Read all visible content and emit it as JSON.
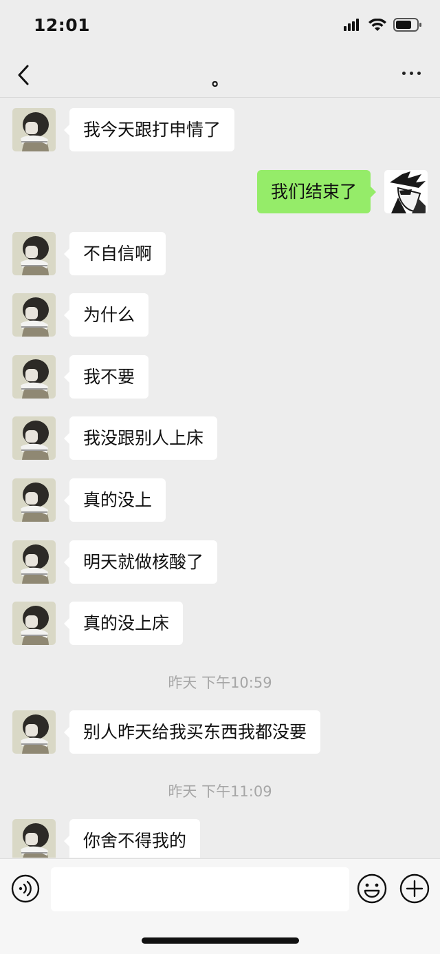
{
  "status_bar": {
    "time": "12:01",
    "signal_icon": "cellular-signal-icon",
    "wifi_icon": "wifi-icon",
    "battery_icon": "battery-icon"
  },
  "header": {
    "title": "。",
    "back_icon": "chevron-left-icon",
    "more_icon": "more-dots-icon"
  },
  "messages": [
    {
      "side": "left",
      "text": "我今天跟打申情了"
    },
    {
      "side": "right",
      "text": "我们结束了"
    },
    {
      "side": "left",
      "text": "不自信啊"
    },
    {
      "side": "left",
      "text": "为什么"
    },
    {
      "side": "left",
      "text": "我不要"
    },
    {
      "side": "left",
      "text": "我没跟别人上床"
    },
    {
      "side": "left",
      "text": "真的没上"
    },
    {
      "side": "left",
      "text": "明天就做核酸了"
    },
    {
      "side": "left",
      "text": "真的没上床"
    },
    {
      "side": "left",
      "text": "别人昨天给我买东西我都没要"
    },
    {
      "side": "left",
      "text": "你舍不得我的"
    }
  ],
  "timestamps": [
    "昨天 下午10:59",
    "昨天 下午11:09"
  ],
  "input_bar": {
    "voice_icon": "voice-icon",
    "emoji_icon": "emoji-icon",
    "plus_icon": "plus-icon",
    "input_value": ""
  },
  "colors": {
    "background": "#ededed",
    "incoming_bubble": "#ffffff",
    "outgoing_bubble": "#95ec69",
    "timestamp_text": "#a6a6a6"
  }
}
